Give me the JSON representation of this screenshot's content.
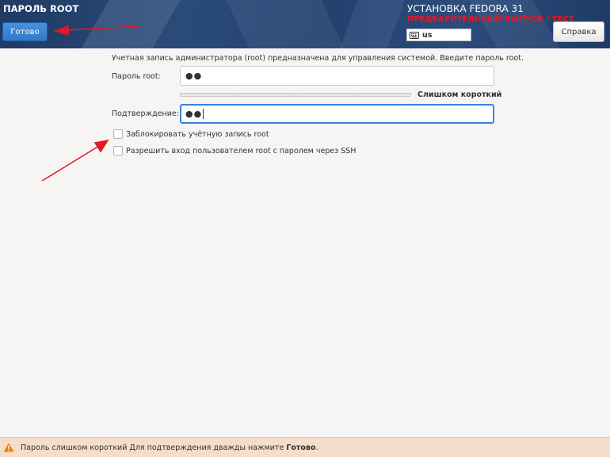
{
  "header": {
    "page_title": "ПАРОЛЬ ROOT",
    "done_label": "Готово",
    "install_title": "УСТАНОВКА FEDORA 31",
    "prerelease_label": "ПРЕДВАРИТЕЛЬНЫЙ ВЫПУСК / ТЕСТ",
    "keyboard_layout": "us",
    "help_label": "Справка"
  },
  "form": {
    "description": "Учетная запись администратора (root) предназначена для управления системой. Введите пароль root.",
    "password_label": "Пароль root:",
    "password_value": "●●",
    "strength_label": "Слишком короткий",
    "strength_fraction": 0,
    "confirm_label": "Подтверждение:",
    "confirm_value": "●●",
    "checkboxes": [
      {
        "label": "Заблокировать учётную запись root",
        "checked": false
      },
      {
        "label": "Разрешить вход пользователем root с паролем через SSH",
        "checked": false
      }
    ]
  },
  "status_bar": {
    "icon": "warning-icon",
    "message": "Пароль слишком короткий Для подтверждения дважды нажмите",
    "emphasis": "Готово",
    "suffix": "."
  },
  "colors": {
    "header_bg": "#22416e",
    "accent": "#3584e4",
    "prerelease": "#e01b24",
    "warning_bg": "#f5ddc9",
    "annotation_arrow": "#e01b24"
  }
}
